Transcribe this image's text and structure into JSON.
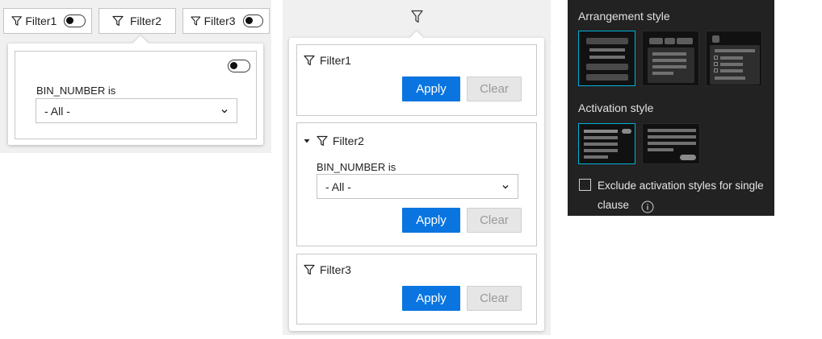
{
  "panel1": {
    "filters": [
      {
        "label": "Filter1",
        "has_toggle": true
      },
      {
        "label": "Filter2",
        "has_toggle": false
      },
      {
        "label": "Filter3",
        "has_toggle": true
      }
    ],
    "popover": {
      "field_label": "BIN_NUMBER is",
      "select_value": "- All -"
    }
  },
  "panel2": {
    "cards": [
      {
        "title": "Filter1",
        "apply_label": "Apply",
        "clear_label": "Clear"
      },
      {
        "title": "Filter2",
        "field_label": "BIN_NUMBER is",
        "select_value": "- All -",
        "apply_label": "Apply",
        "clear_label": "Clear"
      },
      {
        "title": "Filter3",
        "apply_label": "Apply",
        "clear_label": "Clear"
      }
    ]
  },
  "panel3": {
    "arrangement_title": "Arrangement style",
    "activation_title": "Activation style",
    "exclude_label_line1": "Exclude activation styles for single",
    "exclude_label_line2": "clause",
    "exclude_checked": false,
    "arrangement_selected": 0,
    "activation_selected": 0,
    "accent_color": "#00b1d8",
    "icons": [
      "info-icon"
    ]
  },
  "colors": {
    "apply_button": "#0a75e0",
    "dark_panel_bg": "#222222"
  }
}
